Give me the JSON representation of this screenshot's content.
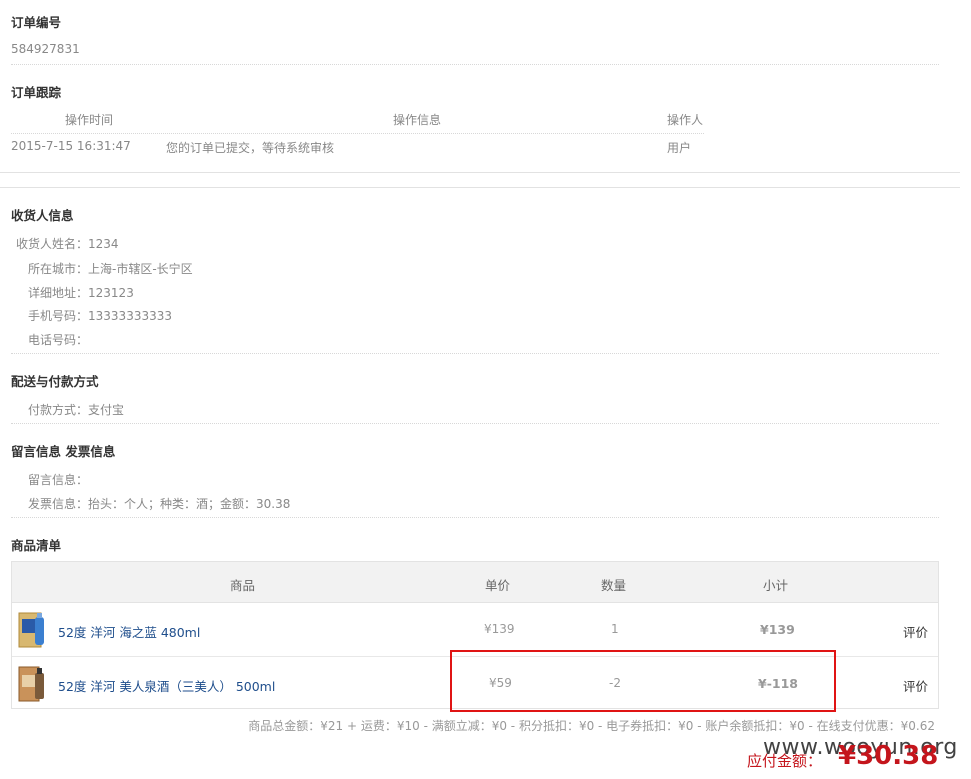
{
  "order": {
    "number_title": "订单编号",
    "number": "584927831"
  },
  "tracking": {
    "title": "订单跟踪",
    "headers": {
      "time": "操作时间",
      "info": "操作信息",
      "operator": "操作人"
    },
    "rows": [
      {
        "time": "2015-7-15 16:31:47",
        "info": "您的订单已提交，等待系统审核",
        "operator": "用户"
      }
    ]
  },
  "consignee": {
    "title": "收货人信息",
    "name_label": "收货人姓名：",
    "name": "1234",
    "city_label": "所在城市：",
    "city": "上海-市辖区-长宁区",
    "address_label": "详细地址：",
    "address": "123123",
    "mobile_label": "手机号码：",
    "mobile": "13333333333",
    "phone_label": "电话号码：",
    "phone": ""
  },
  "delivery": {
    "title": "配送与付款方式",
    "payment_label": "付款方式：",
    "payment": "支付宝"
  },
  "message": {
    "title": "留言信息 发票信息",
    "message_label": "留言信息：",
    "message": "",
    "invoice_label": "发票信息：",
    "invoice": "抬头：个人；种类：酒；金额：30.38"
  },
  "goods": {
    "title": "商品清单",
    "headers": {
      "product": "商品",
      "price": "单价",
      "qty": "数量",
      "subtotal": "小计"
    },
    "rows": [
      {
        "name": "52度 洋河 海之蓝 480ml",
        "price": "¥139",
        "qty": "1",
        "subtotal": "¥139",
        "action": "评价"
      },
      {
        "name": "52度 洋河 美人泉酒（三美人） 500ml",
        "price": "¥59",
        "qty": "-2",
        "subtotal": "¥-118",
        "action": "评价"
      }
    ],
    "summary": "商品总金额：¥21 + 运费：¥10 - 满额立减：¥0 - 积分抵扣：¥0 - 电子券抵扣：¥0 - 账户余额抵扣：¥0 - 在线支付优惠：¥0.62",
    "payable_label": "应付金额：",
    "payable_amount": "¥30.38"
  },
  "watermark": "www.wooyun.org",
  "colors": {
    "accent_red": "#c4151c",
    "link_blue": "#1f4e8c",
    "highlight_box": "#e01414"
  }
}
